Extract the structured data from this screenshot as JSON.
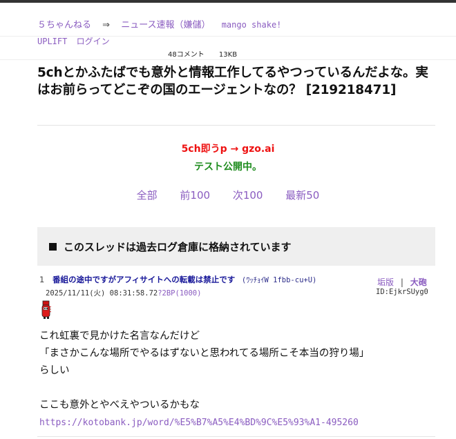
{
  "breadcrumb": {
    "site": "５ちゃんねる",
    "arrow": "⇒",
    "board": "ニュース速報（嫌儲）",
    "extra": "mango shake!"
  },
  "nav2": {
    "uplift": "UPLIFT",
    "login": "ログイン"
  },
  "meta": {
    "comments": "48コメント",
    "size": "13KB"
  },
  "thread": {
    "title": "5chとかふたばでも意外と情報工作してるやつっているんだよな。実はお前らってどこぞの国のエージェントなの？ [219218471]"
  },
  "promo": {
    "line1": "5ch即うp → gzo.ai",
    "line2": "テスト公開中。"
  },
  "pager": {
    "all": "全部",
    "prev": "前100",
    "next": "次100",
    "latest": "最新50"
  },
  "archive": {
    "notice": "このスレッドは過去ログ倉庫に格納されています"
  },
  "post": {
    "number": "1",
    "name": "番組の途中ですがアフィサイトへの転載は禁止です",
    "trip": "(ﾜｯﾁｮｲW 1fbb-cu+U)",
    "action_ng": "垢版",
    "action_sep": "|",
    "action_report": "大砲",
    "date": "2025/11/11(火) 08:31:58.72",
    "be": "?2BP(1000)",
    "id": "ID:EjkrSUyg0",
    "lines": [
      "これ虹裏で見かけた名言なんだけど",
      "「まさかこんな場所でやるはずないと思われてる場所こそ本当の狩り場」",
      "らしい",
      "",
      "ここも意外とやべえやついるかもな"
    ],
    "link": "https://kotobank.jp/word/%E5%B7%A5%E4%BD%9C%E5%93%A1-495260"
  },
  "colors": {
    "link": "#8a5cc0",
    "promo_red": "#ee1111",
    "promo_green": "#1e8c1e",
    "name_blue": "#1a1a9a"
  }
}
